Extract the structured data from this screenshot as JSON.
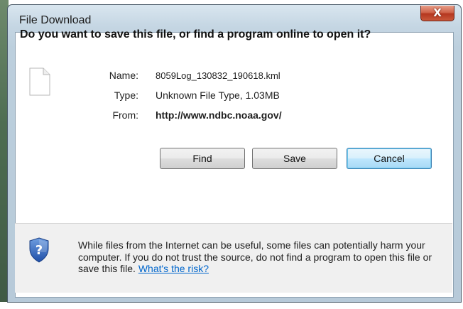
{
  "window": {
    "title": "File Download",
    "close_glyph": "X"
  },
  "dialog": {
    "question": "Do you want to save this file, or find a program online to open it?",
    "file_icon": "blank-file-icon",
    "fields": {
      "name_label": "Name:",
      "name_value": "8059Log_130832_190618.kml",
      "type_label": "Type:",
      "type_value": "Unknown File Type, 1.03MB",
      "from_label": "From:",
      "from_value": "http://www.ndbc.noaa.gov/"
    },
    "buttons": {
      "find": "Find",
      "save": "Save",
      "cancel": "Cancel"
    }
  },
  "footer": {
    "icon": "security-shield-question-icon",
    "warning_text": "While files from the Internet can be useful, some files can potentially harm your computer. If you do not trust the source, do not find a program to open this file or save this file.",
    "risk_link": "What's the risk?"
  },
  "colors": {
    "link": "#0066cc",
    "close_button": "#c9583b",
    "default_button_border": "#3c7fb1"
  }
}
